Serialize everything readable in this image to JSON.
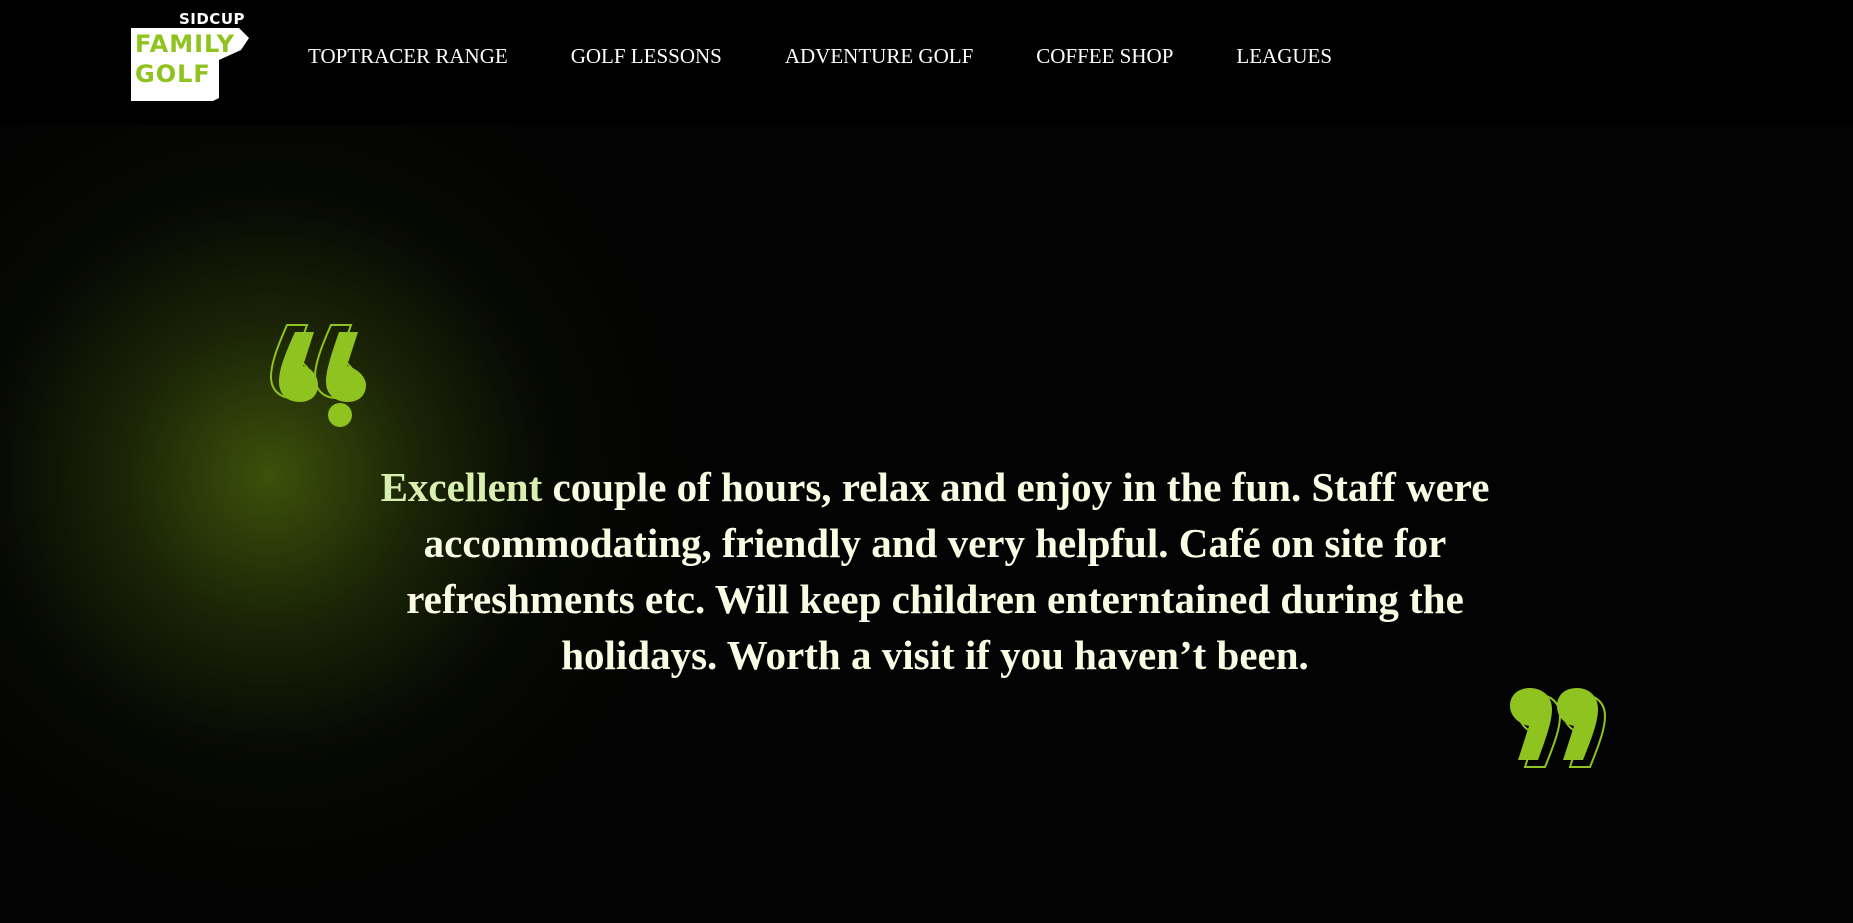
{
  "brand": {
    "top": "SIDCUP",
    "line1": "FAMILY",
    "line2": "GOLF",
    "accent_color": "#8fc31f"
  },
  "nav": {
    "items": [
      {
        "label": "TOPTRACER RANGE"
      },
      {
        "label": "GOLF LESSONS"
      },
      {
        "label": "ADVENTURE GOLF"
      },
      {
        "label": "COFFEE SHOP"
      },
      {
        "label": "LEAGUES"
      }
    ]
  },
  "testimonial": {
    "first_word": "Excellent",
    "text": " couple of hours, relax and enjoy in the fun. Staff were accommodating, friendly and very helpful. Café on site for refreshments etc. Will keep children enterntained during the holidays. Worth a visit if you haven’t been.",
    "open_icon": "quote-open-icon",
    "close_icon": "quote-close-icon"
  }
}
